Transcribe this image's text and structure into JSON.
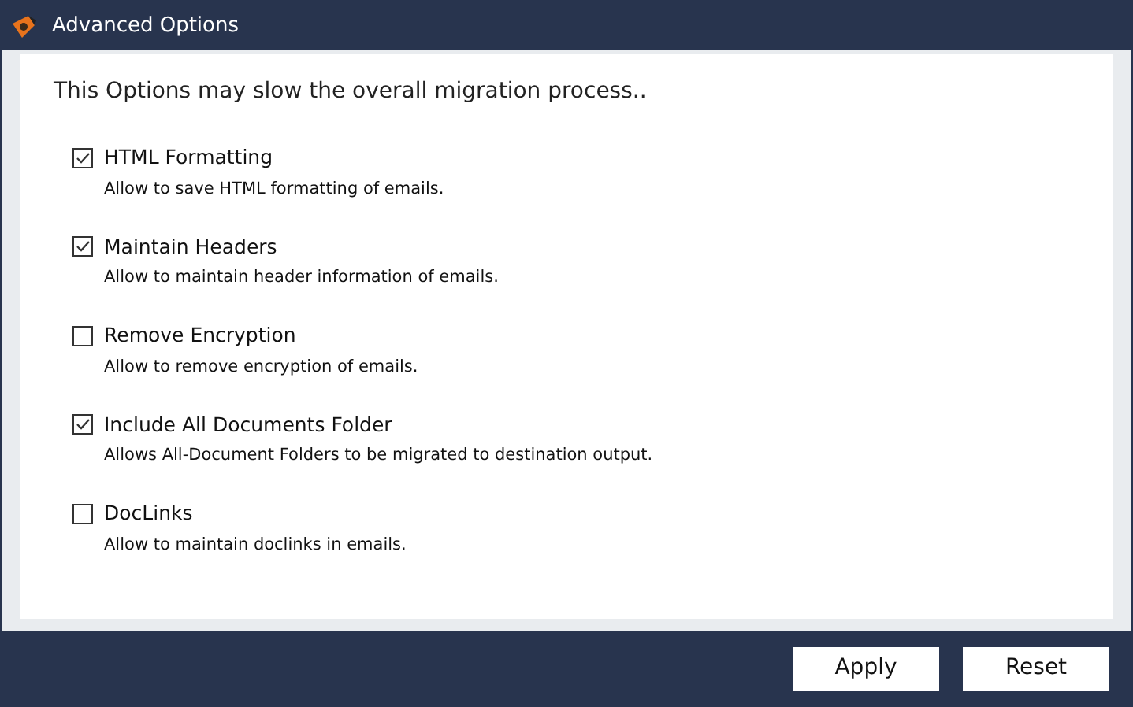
{
  "window": {
    "title": "Advanced Options"
  },
  "notice": "This Options may slow the overall migration process..",
  "options": [
    {
      "label": "HTML Formatting",
      "description": "Allow to save HTML formatting of emails.",
      "checked": true
    },
    {
      "label": "Maintain Headers",
      "description": "Allow to maintain header information of emails.",
      "checked": true
    },
    {
      "label": "Remove Encryption",
      "description": "Allow to remove encryption of emails.",
      "checked": false
    },
    {
      "label": "Include All Documents Folder",
      "description": "Allows All-Document Folders to be migrated to destination output.",
      "checked": true
    },
    {
      "label": "DocLinks",
      "description": "Allow to maintain doclinks in emails.",
      "checked": false
    }
  ],
  "buttons": [
    "Apply",
    "Reset"
  ]
}
